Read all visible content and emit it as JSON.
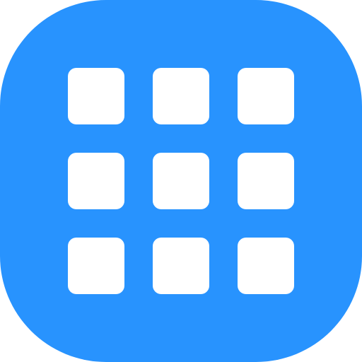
{
  "icon": {
    "name": "apps-grid-icon",
    "background_color": "#2893FE",
    "tile_color": "#FFFFFF",
    "rows": 3,
    "columns": 3,
    "tiles": [
      {
        "name": "grid-tile-1"
      },
      {
        "name": "grid-tile-2"
      },
      {
        "name": "grid-tile-3"
      },
      {
        "name": "grid-tile-4"
      },
      {
        "name": "grid-tile-5"
      },
      {
        "name": "grid-tile-6"
      },
      {
        "name": "grid-tile-7"
      },
      {
        "name": "grid-tile-8"
      },
      {
        "name": "grid-tile-9"
      }
    ]
  }
}
